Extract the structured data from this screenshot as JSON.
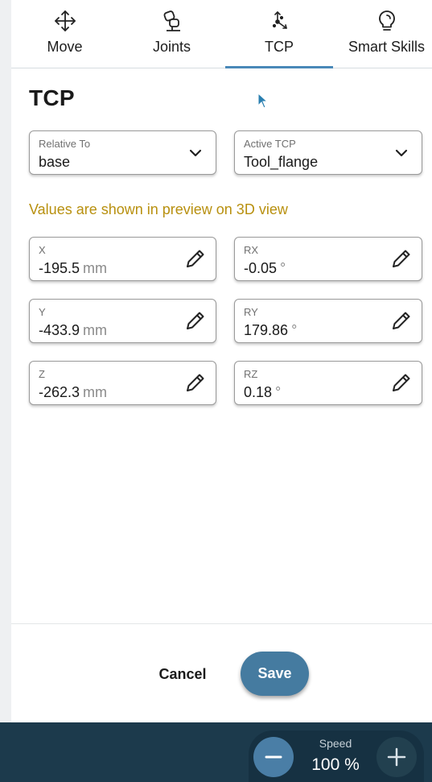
{
  "tabs": [
    {
      "label": "Move",
      "icon": "move-icon"
    },
    {
      "label": "Joints",
      "icon": "joints-icon"
    },
    {
      "label": "TCP",
      "icon": "tcp-icon"
    },
    {
      "label": "Smart Skills",
      "icon": "lightbulb-icon"
    }
  ],
  "active_tab": "TCP",
  "page": {
    "title": "TCP"
  },
  "selects": {
    "relative_to": {
      "label": "Relative To",
      "value": "base"
    },
    "active_tcp": {
      "label": "Active TCP",
      "value": "Tool_flange"
    }
  },
  "info_text": "Values are shown in preview on 3D view",
  "position": {
    "x": {
      "label": "X",
      "value": "-195.5",
      "unit": "mm"
    },
    "y": {
      "label": "Y",
      "value": "-433.9",
      "unit": "mm"
    },
    "z": {
      "label": "Z",
      "value": "-262.3",
      "unit": "mm"
    }
  },
  "rotation": {
    "rx": {
      "label": "RX",
      "value": "-0.05",
      "unit": "°"
    },
    "ry": {
      "label": "RY",
      "value": "179.86",
      "unit": "°"
    },
    "rz": {
      "label": "RZ",
      "value": "0.18",
      "unit": "°"
    }
  },
  "actions": {
    "cancel": "Cancel",
    "save": "Save"
  },
  "speed": {
    "label": "Speed",
    "value": "100 %"
  },
  "colors": {
    "accent": "#4a89b8",
    "save": "#457ba0",
    "info": "#b8900f",
    "bottom_bar": "#1c3a4c"
  }
}
